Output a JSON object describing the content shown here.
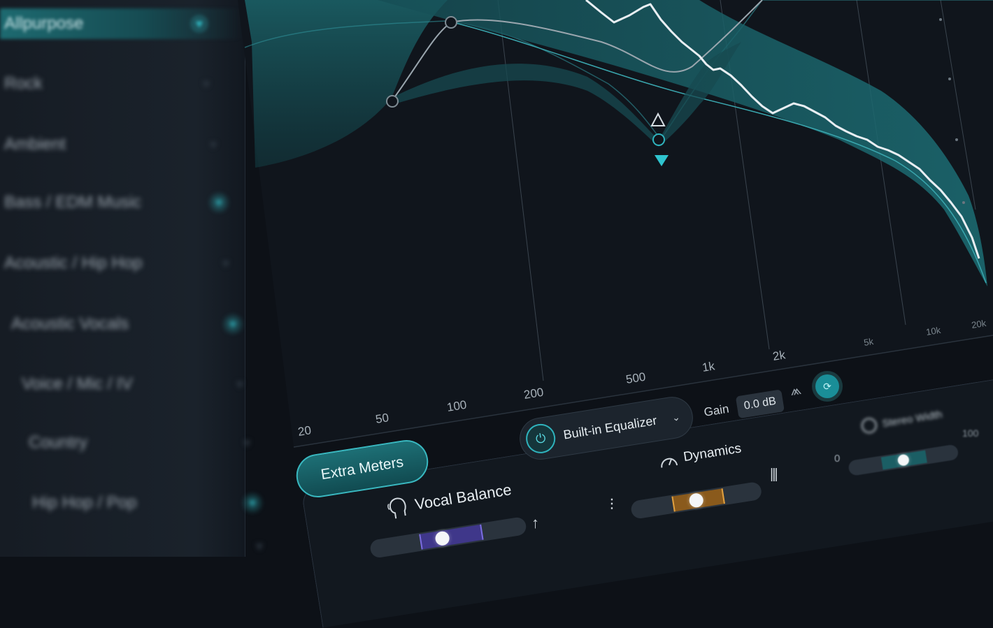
{
  "sidebar": {
    "items": [
      {
        "label": "Allpurpose",
        "active": true,
        "favorite": true
      },
      {
        "label": "Rock",
        "active": false,
        "favorite": false
      },
      {
        "label": "Ambient",
        "active": false,
        "favorite": false
      },
      {
        "label": "Bass / EDM Music",
        "active": false,
        "favorite": true
      },
      {
        "label": "Acoustic / Hip Hop",
        "active": false,
        "favorite": false
      },
      {
        "label": "Acoustic Vocals",
        "active": false,
        "favorite": true
      },
      {
        "label": "Voice / Mic / IV",
        "active": false,
        "favorite": false
      },
      {
        "label": "Country",
        "active": false,
        "favorite": false
      },
      {
        "label": "Hip Hop / Pop",
        "active": false,
        "favorite": true
      },
      {
        "label": "",
        "active": false,
        "favorite": false
      }
    ]
  },
  "eq": {
    "freq_labels": [
      "20",
      "50",
      "100",
      "200",
      "500",
      "1k",
      "2k",
      "5k",
      "10k",
      "20k"
    ]
  },
  "controls": {
    "extra_meters_label": "Extra Meters",
    "eq_selector_label": "Built-in Equalizer",
    "gain_label": "Gain",
    "gain_value": "0.0 dB"
  },
  "meters": {
    "vocal_balance": {
      "label": "Vocal Balance",
      "position": 0.46
    },
    "dynamics": {
      "label": "Dynamics",
      "position": 0.5
    },
    "stereo_width": {
      "label": "Stereo Width",
      "min_label": "0",
      "max_label": "100",
      "position": 0.5
    }
  },
  "colors": {
    "accent": "#2fb3bd",
    "teal_fill": "#1f6b72",
    "vocal_zone": "#4a3f9a",
    "dynamics_zone": "#a0661f",
    "background": "#0d1117"
  }
}
